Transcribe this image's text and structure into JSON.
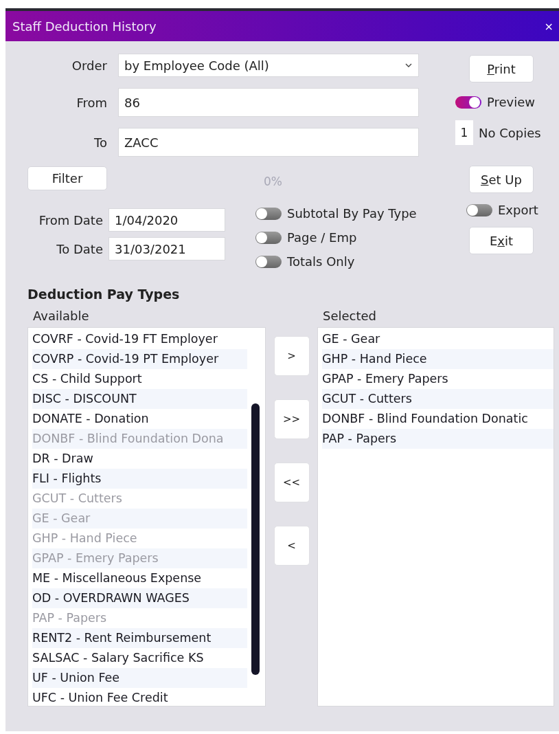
{
  "window": {
    "title": "Staff Deduction History",
    "close": "×"
  },
  "fields": [
    {
      "label": "Order",
      "kind": "dropdown",
      "value": "by Employee Code (All)"
    },
    {
      "label": "From",
      "kind": "text",
      "value": "86"
    },
    {
      "label": "To",
      "kind": "text",
      "value": "ZACC"
    }
  ],
  "filter_button": "Filter",
  "progress_text": "0%",
  "dates": [
    {
      "label": "From Date",
      "value": "1/04/2020"
    },
    {
      "label": "To Date",
      "value": "31/03/2021"
    }
  ],
  "options": [
    {
      "label": "Subtotal By Pay Type",
      "on": false
    },
    {
      "label": "Page / Emp",
      "on": false
    },
    {
      "label": "Totals Only",
      "on": false
    }
  ],
  "print_button": {
    "key": "P",
    "post": "rint"
  },
  "preview": {
    "label": "Preview",
    "on": true
  },
  "copies": {
    "value": "1",
    "label": "No Copies"
  },
  "setup_button": {
    "key": "S",
    "post": "et Up"
  },
  "export": {
    "label": "Export",
    "on": false
  },
  "exit_button": {
    "pre": "E",
    "key": "x",
    "post": "it"
  },
  "section_title": "Deduction Pay Types",
  "available": {
    "label": "Available",
    "items": [
      {
        "text": "COVRF - Covid-19 FT Employer",
        "disabled": false
      },
      {
        "text": "COVRP - Covid-19 PT Employer",
        "disabled": false
      },
      {
        "text": "CS - Child Support",
        "disabled": false
      },
      {
        "text": "DISC - DISCOUNT",
        "disabled": false
      },
      {
        "text": "DONATE - Donation",
        "disabled": false
      },
      {
        "text": "DONBF - Blind Foundation Dona",
        "disabled": true
      },
      {
        "text": "DR - Draw",
        "disabled": false
      },
      {
        "text": "FLI - Flights",
        "disabled": false
      },
      {
        "text": "GCUT - Cutters",
        "disabled": true
      },
      {
        "text": "GE - Gear",
        "disabled": true
      },
      {
        "text": "GHP - Hand Piece",
        "disabled": true
      },
      {
        "text": "GPAP - Emery Papers",
        "disabled": true
      },
      {
        "text": "ME - Miscellaneous Expense",
        "disabled": false
      },
      {
        "text": "OD - OVERDRAWN WAGES",
        "disabled": false
      },
      {
        "text": "PAP - Papers",
        "disabled": true
      },
      {
        "text": "RENT2 - Rent Reimbursement",
        "disabled": false
      },
      {
        "text": "SALSAC - Salary Sacrifice KS",
        "disabled": false
      },
      {
        "text": "UF - Union Fee",
        "disabled": false
      },
      {
        "text": "UFC - Union Fee Credit",
        "disabled": false
      }
    ]
  },
  "move_buttons": [
    ">",
    ">>",
    "<<",
    "<"
  ],
  "selected": {
    "label": "Selected",
    "items": [
      {
        "text": "GE - Gear"
      },
      {
        "text": "GHP - Hand Piece"
      },
      {
        "text": "GPAP - Emery Papers"
      },
      {
        "text": "GCUT - Cutters"
      },
      {
        "text": "DONBF - Blind Foundation Donatic"
      },
      {
        "text": "PAP - Papers"
      }
    ]
  }
}
